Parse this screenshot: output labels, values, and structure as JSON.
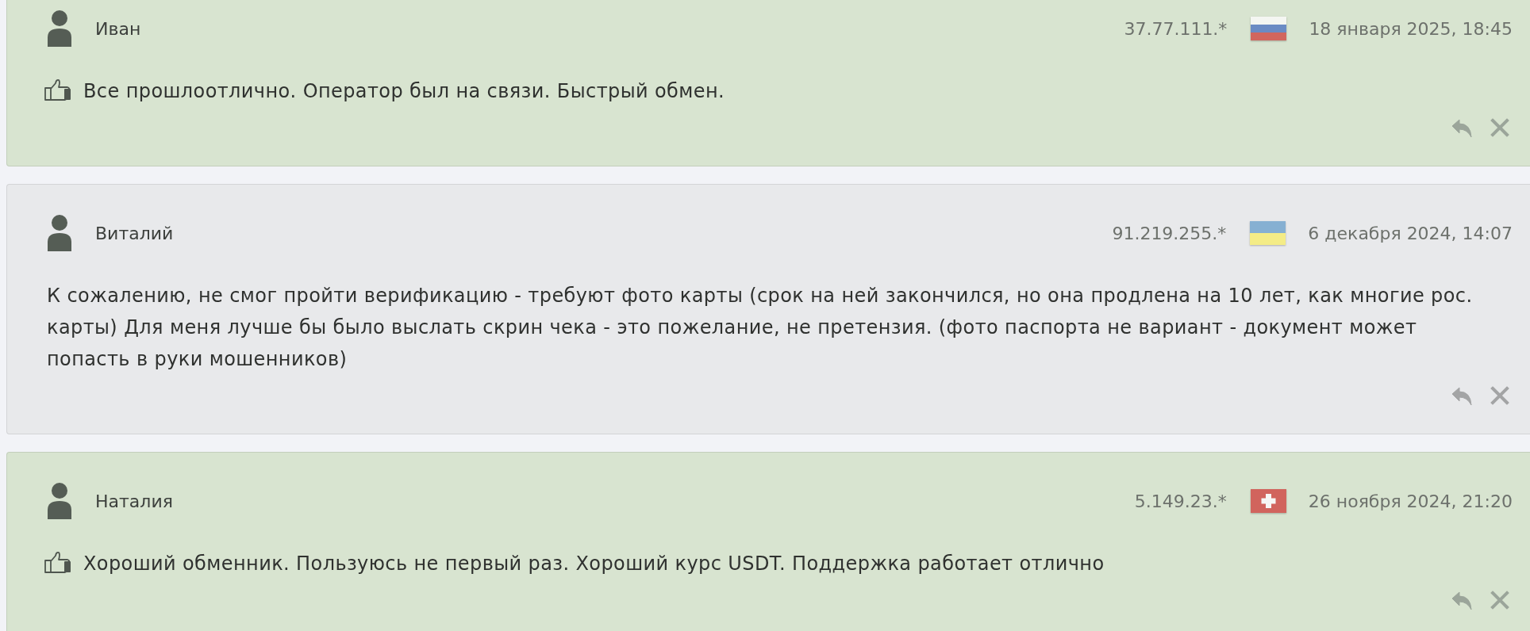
{
  "reviews": [
    {
      "kind": "positive",
      "author": "Иван",
      "ip": "37.77.111.*",
      "country_flag": {
        "kind": "ru"
      },
      "date": "18 января 2025, 18:45",
      "text": "Все прошлоотлично. Оператор был на связи. Быстрый обмен."
    },
    {
      "kind": "neutral",
      "author": "Виталий",
      "ip": "91.219.255.*",
      "country_flag": {
        "kind": "ua"
      },
      "date": "6 декабря 2024, 14:07",
      "text": "К сожалению, не смог пройти верификацию - требуют фото карты (срок на ней закончился, но она продлена на 10 лет, как многие рос. карты) Для меня лучше бы было выслать скрин чека - это пожелание, не претензия. (фото паспорта не вариант - документ может попасть в руки мошенников)"
    },
    {
      "kind": "positive",
      "author": "Наталия",
      "ip": "5.149.23.*",
      "country_flag": {
        "kind": "ch"
      },
      "date": "26 ноября 2024, 21:20",
      "text": "Хороший обменник. Пользуюсь не первый раз. Хороший курс USDT. Поддержка работает отлично"
    }
  ]
}
